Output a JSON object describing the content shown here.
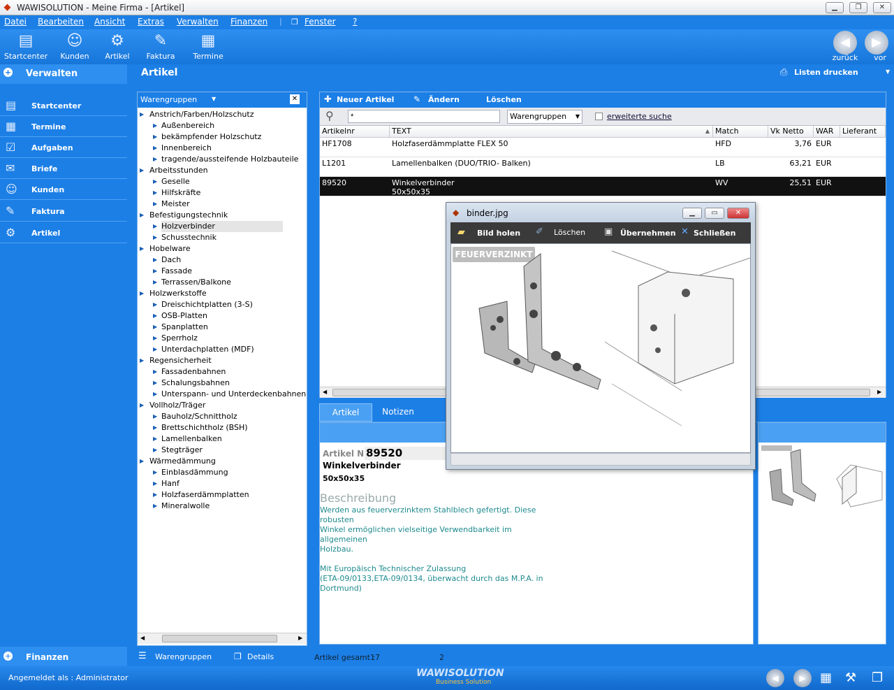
{
  "window": {
    "title": "WAWISOLUTION - Meine Firma - [Artikel]"
  },
  "menu": [
    "Datei",
    "Bearbeiten",
    "Ansicht",
    "Extras",
    "Verwalten",
    "Finanzen",
    "Fenster",
    "?"
  ],
  "toolbar": {
    "items": [
      {
        "label": "Startcenter",
        "icon": "startcenter-icon"
      },
      {
        "label": "Kunden",
        "icon": "people-icon"
      },
      {
        "label": "Artikel",
        "icon": "gear-icon"
      },
      {
        "label": "Faktura",
        "icon": "faktura-icon"
      },
      {
        "label": "Termine",
        "icon": "calendar-icon"
      }
    ],
    "back": "zurück",
    "forward": "vor"
  },
  "sidebar": {
    "header": "Verwalten",
    "items": [
      "Startcenter",
      "Termine",
      "Aufgaben",
      "Briefe",
      "Kunden",
      "Faktura",
      "Artikel"
    ],
    "footer": "Finanzen"
  },
  "page": {
    "title": "Artikel",
    "print": "Listen drucken"
  },
  "tree": {
    "header": "Warengruppen",
    "groups": [
      {
        "label": "Anstrich/Farben/Holzschutz",
        "children": [
          "Außenbereich",
          "bekämpfender Holzschutz",
          "Innenbereich",
          "tragende/aussteifende Holzbauteile"
        ]
      },
      {
        "label": "Arbeitsstunden",
        "children": [
          "Geselle",
          "Hilfskräfte",
          "Meister"
        ]
      },
      {
        "label": "Befestigungstechnik",
        "children": [
          "Holzverbinder",
          "Schusstechnik"
        ]
      },
      {
        "label": "Hobelware",
        "children": [
          "Dach",
          "Fassade",
          "Terrassen/Balkone"
        ]
      },
      {
        "label": "Holzwerkstoffe",
        "children": [
          "Dreischichtplatten (3-S)",
          "OSB-Platten",
          "Spanplatten",
          "Sperrholz",
          "Unterdachplatten (MDF)"
        ]
      },
      {
        "label": "Regensicherheit",
        "children": [
          "Fassadenbahnen",
          "Schalungsbahnen",
          "Unterspann- und Unterdeckenbahnen"
        ]
      },
      {
        "label": "Vollholz/Träger",
        "children": [
          "Bauholz/Schnittholz",
          "Brettschichtholz (BSH)",
          "Lamellenbalken",
          "Stegträger"
        ]
      },
      {
        "label": "Wärmedämmung",
        "children": [
          "Einblasdämmung",
          "Hanf",
          "Holzfaserdämmplatten",
          "Mineralwolle"
        ]
      }
    ],
    "selected": "Holzverbinder"
  },
  "grid": {
    "actions": {
      "new": "Neuer Artikel",
      "edit": "Ändern",
      "delete": "Löschen"
    },
    "search": {
      "value": "*",
      "filter": "Warengruppen",
      "extended": "erweiterte suche"
    },
    "columns": [
      "Artikelnr",
      "TEXT",
      "Match",
      "Vk Netto",
      "WAR",
      "Lieferant"
    ],
    "rows": [
      {
        "nr": "HF1708",
        "text": "Holzfaserdämmplatte FLEX 50",
        "text2": "",
        "match": "HFD",
        "vk": "3,76",
        "war": "EUR",
        "lief": ""
      },
      {
        "nr": "L1201",
        "text": "Lamellenbalken (DUO/TRIO- Balken)",
        "text2": "",
        "match": "LB",
        "vk": "63,21",
        "war": "EUR",
        "lief": ""
      },
      {
        "nr": "89520",
        "text": "Winkelverbinder",
        "text2": "50x50x35",
        "match": "WV",
        "vk": "25,51",
        "war": "EUR",
        "lief": ""
      }
    ]
  },
  "tabs": [
    "Artikel",
    "Notizen"
  ],
  "detail": {
    "nr_label": "Artikel Nr:",
    "nr": "89520",
    "name": "Winkelverbinder",
    "size": "50x50x35",
    "desc_title": "Beschreibung",
    "desc": [
      "Werden aus feuerverzinktem Stahlblech gefertigt. Diese",
      "robusten",
      "Winkel ermöglichen vielseitige Verwendbarkeit im allgemeinen",
      "Holzbau.",
      "",
      "Mit Europäisch Technischer Zulassung",
      "(ETA-09/0133,ETA-09/0134, überwacht durch das M.P.A. in",
      "Dortmund)"
    ]
  },
  "popup": {
    "title": "binder.jpg",
    "buttons": [
      "Bild holen",
      "Löschen",
      "Übernehmen",
      "Schließen"
    ],
    "badge": "FEUERVERZINKT"
  },
  "status": {
    "tree_tab": "Warengruppen",
    "details_tab": "Details",
    "count_label": "Artikel gesamt :",
    "count": "17",
    "extra": "2"
  },
  "bottom": {
    "user": "Angemeldet als : Administrator",
    "brand": "WAWISOLUTION",
    "brand_sub": "Business Solution"
  }
}
